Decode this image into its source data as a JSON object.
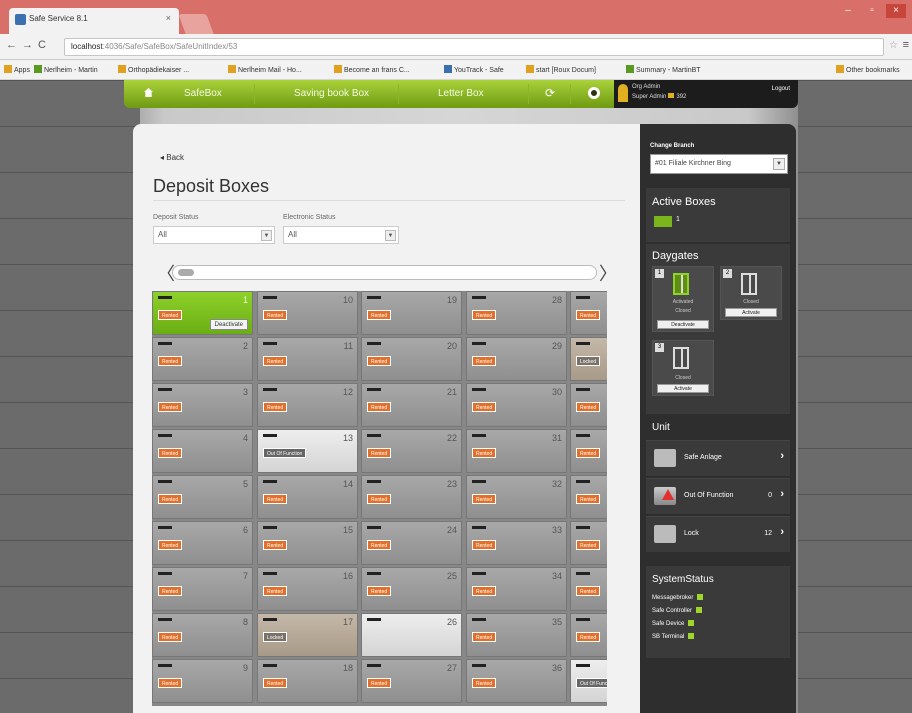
{
  "browser": {
    "tab_title": "Safe Service 8.1",
    "url_host": "localhost",
    "url_path": ":4036/Safe/SafeBox/SafeUnitIndex/53",
    "bookmarks": [
      "Apps",
      "Nerlheim - Martin",
      "Orthopädiekaiser ...",
      "Nerlheim Mail - Ho...",
      "Become an frans C...",
      "YouTrack - Safe",
      "start [Roux Docum]",
      "Summary - MartinBT",
      "Other bookmarks"
    ]
  },
  "topnav": {
    "items": [
      "SafeBox",
      "Saving book Box",
      "Letter Box"
    ],
    "user_name": "Org Admin",
    "user_role": "Super Admin",
    "user_count": "392",
    "logout": "Logout"
  },
  "main": {
    "back": "Back",
    "title": "Deposit Boxes",
    "filter1_label": "Deposit Status",
    "filter1_value": "All",
    "filter2_label": "Electronic Status",
    "filter2_value": "All"
  },
  "boxes": {
    "col0": [
      {
        "num": "1",
        "status": "Rented",
        "style": "green",
        "action": "Deactivate"
      },
      {
        "num": "2",
        "status": "Rented",
        "style": "gray"
      },
      {
        "num": "3",
        "status": "Rented",
        "style": "gray"
      },
      {
        "num": "4",
        "status": "Rented",
        "style": "gray"
      },
      {
        "num": "5",
        "status": "Rented",
        "style": "gray"
      },
      {
        "num": "6",
        "status": "Rented",
        "style": "gray"
      },
      {
        "num": "7",
        "status": "Rented",
        "style": "gray"
      },
      {
        "num": "8",
        "status": "Rented",
        "style": "gray"
      },
      {
        "num": "9",
        "status": "Rented",
        "style": "gray"
      }
    ],
    "col1": [
      {
        "num": "10",
        "status": "Rented",
        "style": "gray"
      },
      {
        "num": "11",
        "status": "Rented",
        "style": "gray"
      },
      {
        "num": "12",
        "status": "Rented",
        "style": "gray"
      },
      {
        "num": "13",
        "status": "Out Of Function",
        "style": "white"
      },
      {
        "num": "14",
        "status": "Rented",
        "style": "gray"
      },
      {
        "num": "15",
        "status": "Rented",
        "style": "gray"
      },
      {
        "num": "16",
        "status": "Rented",
        "style": "gray"
      },
      {
        "num": "17",
        "status": "Locked",
        "style": "tan"
      },
      {
        "num": "18",
        "status": "Rented",
        "style": "gray"
      }
    ],
    "col2": [
      {
        "num": "19",
        "status": "Rented",
        "style": "gray"
      },
      {
        "num": "20",
        "status": "Rented",
        "style": "gray"
      },
      {
        "num": "21",
        "status": "Rented",
        "style": "gray"
      },
      {
        "num": "22",
        "status": "Rented",
        "style": "gray"
      },
      {
        "num": "23",
        "status": "Rented",
        "style": "gray"
      },
      {
        "num": "24",
        "status": "Rented",
        "style": "gray"
      },
      {
        "num": "25",
        "status": "Rented",
        "style": "gray"
      },
      {
        "num": "26",
        "status": "",
        "style": "white"
      },
      {
        "num": "27",
        "status": "Rented",
        "style": "gray"
      }
    ],
    "col3": [
      {
        "num": "28",
        "status": "Rented",
        "style": "gray"
      },
      {
        "num": "29",
        "status": "Rented",
        "style": "gray"
      },
      {
        "num": "30",
        "status": "Rented",
        "style": "gray"
      },
      {
        "num": "31",
        "status": "Rented",
        "style": "gray"
      },
      {
        "num": "32",
        "status": "Rented",
        "style": "gray"
      },
      {
        "num": "33",
        "status": "Rented",
        "style": "gray"
      },
      {
        "num": "34",
        "status": "Rented",
        "style": "gray"
      },
      {
        "num": "35",
        "status": "Rented",
        "style": "gray"
      },
      {
        "num": "36",
        "status": "Rented",
        "style": "gray"
      }
    ],
    "col4": [
      {
        "num": "",
        "status": "Rented",
        "style": "gray"
      },
      {
        "num": "",
        "status": "Locked",
        "style": "tan"
      },
      {
        "num": "",
        "status": "Rented",
        "style": "gray"
      },
      {
        "num": "",
        "status": "Rented",
        "style": "gray"
      },
      {
        "num": "",
        "status": "Rented",
        "style": "gray"
      },
      {
        "num": "",
        "status": "Rented",
        "style": "gray"
      },
      {
        "num": "",
        "status": "Rented",
        "style": "gray"
      },
      {
        "num": "",
        "status": "Rented",
        "style": "gray"
      },
      {
        "num": "",
        "status": "Out Of Function",
        "style": "white"
      }
    ]
  },
  "panel": {
    "change_branch": "Change Branch",
    "branch_value": "#01 Filiale Kirchner Bing",
    "active_boxes_title": "Active Boxes",
    "active_boxes_count": "1",
    "daygates_title": "Daygates",
    "daygates": [
      {
        "id": "1",
        "line1": "Activated",
        "line2": "Closed",
        "button": "Deactivate"
      },
      {
        "id": "2",
        "line1": "",
        "line2": "Closed",
        "button": "Activate"
      },
      {
        "id": "3",
        "line1": "",
        "line2": "Closed",
        "button": "Activate"
      }
    ],
    "unit_title": "Unit",
    "unit_rows": [
      {
        "label": "Safe Anlage",
        "count": ""
      },
      {
        "label": "Out Of Function",
        "count": "0"
      },
      {
        "label": "Lock",
        "count": "12"
      }
    ],
    "system_title": "SystemStatus",
    "system_items": [
      "Messagebroker",
      "Safe Controller",
      "Safe Device",
      "SB Terminal"
    ]
  },
  "colors": {
    "accent_green": "#7ab51d",
    "rented_orange": "#e2702a",
    "panel_dark": "#2e2e2e"
  }
}
